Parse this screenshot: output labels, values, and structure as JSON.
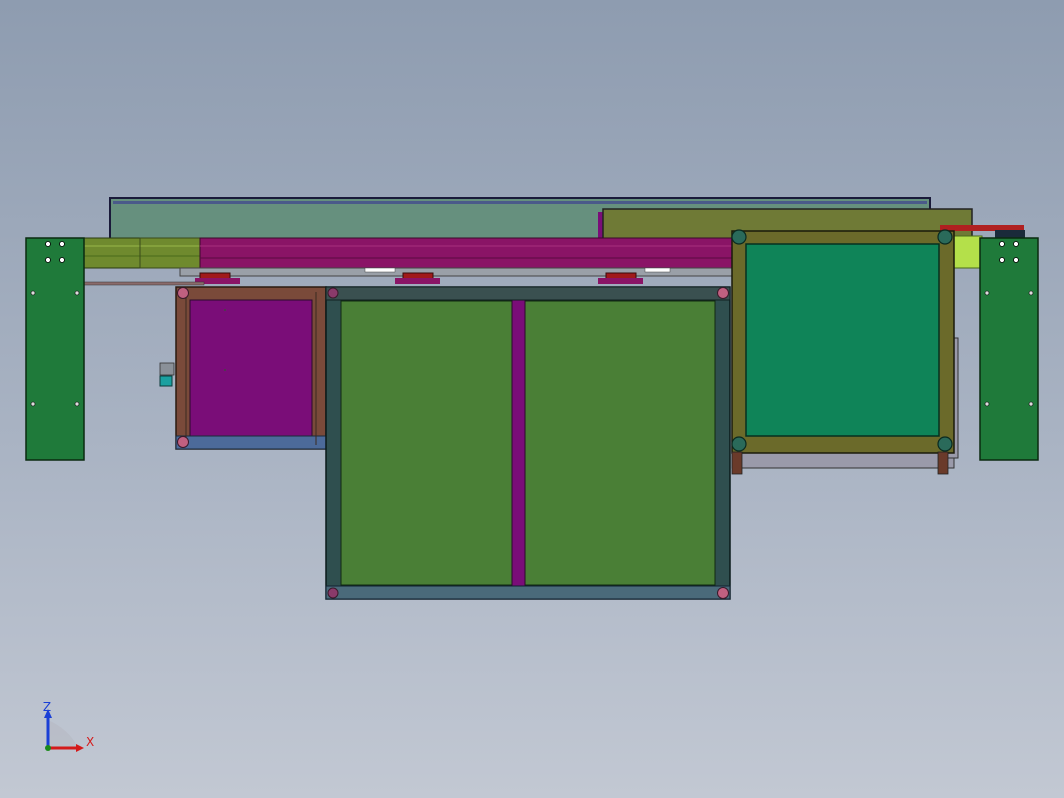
{
  "viewport": {
    "view": "front",
    "background_top": "#8e9cb0",
    "background_bottom": "#c2c8d3"
  },
  "model": {
    "parts": [
      {
        "name": "top-rail-panel",
        "color": "#66907e"
      },
      {
        "name": "upper-right-panel",
        "color": "#6f7a36"
      },
      {
        "name": "magenta-beam",
        "color": "#8a1466"
      },
      {
        "name": "left-olive-beam",
        "color": "#6f8a2e"
      },
      {
        "name": "left-side-plate",
        "color": "#1f7a3a"
      },
      {
        "name": "right-side-plate",
        "color": "#1f7a3a"
      },
      {
        "name": "small-frame",
        "color": "#7a4a3a"
      },
      {
        "name": "small-frame-fill",
        "color": "#7a0d78"
      },
      {
        "name": "large-frame",
        "color": "#2f4f4f"
      },
      {
        "name": "large-frame-fill",
        "color": "#4a7f36"
      },
      {
        "name": "frame-divider",
        "color": "#7a0d78"
      },
      {
        "name": "olive-frame",
        "color": "#6b6a2a"
      },
      {
        "name": "olive-frame-fill",
        "color": "#0f8458"
      },
      {
        "name": "bottom-blue-rail",
        "color": "#4c6a9a"
      }
    ]
  },
  "triad": {
    "z_label": "Z",
    "x_label": "X",
    "z_color": "#1a3fd6",
    "x_color": "#d41a1a"
  }
}
